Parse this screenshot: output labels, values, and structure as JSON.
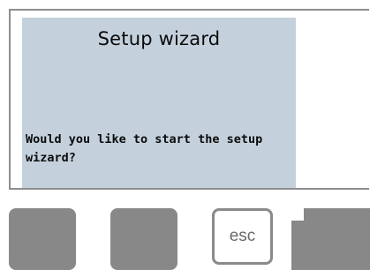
{
  "display": {
    "title": "Setup wizard",
    "message": "Would you like to start the setup wizard?"
  },
  "keys": {
    "esc_label": "esc"
  },
  "colors": {
    "lcd_background": "#c4d1dd",
    "key_gray": "#888888",
    "frame_border": "#8e8e8e"
  }
}
